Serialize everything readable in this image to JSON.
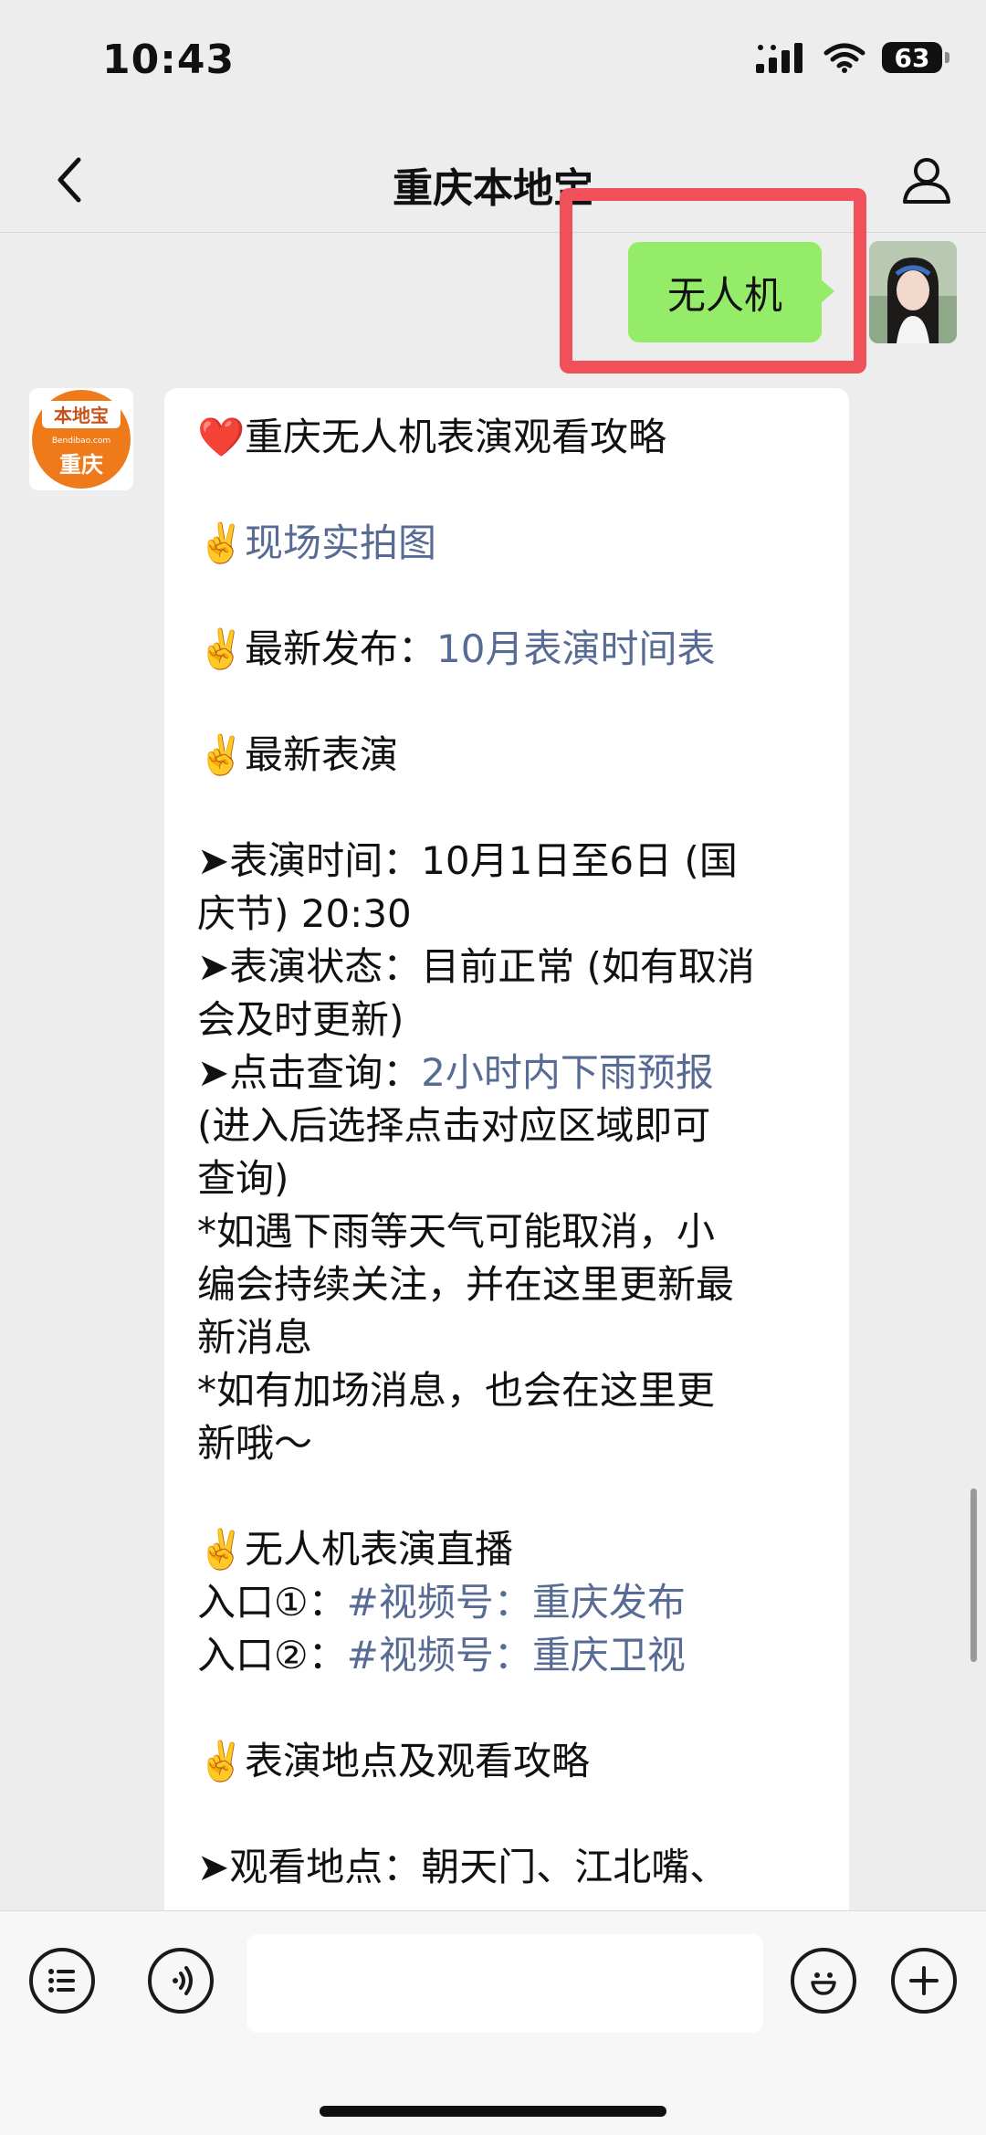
{
  "status_bar": {
    "time": "10:43",
    "battery": "63"
  },
  "nav": {
    "title": "重庆本地宝"
  },
  "sent": {
    "text": "无人机"
  },
  "bot_avatar": {
    "top": "本地宝",
    "url": "Bendibao.com",
    "city": "重庆"
  },
  "message": {
    "l01": "重庆无人机表演观看攻略",
    "l02": "现场实拍图",
    "l03_pre": "最新发布：",
    "l03_link": "10月表演时间表",
    "l04": "最新表演",
    "l05": "➤表演时间：10月1日至6日 (国",
    "l06": "庆节) 20:30",
    "l07": "➤表演状态：目前正常 (如有取消",
    "l08": "会及时更新)",
    "l09_pre": "➤点击查询：",
    "l09_link": "2小时内下雨预报",
    "l10": "(进入后选择点击对应区域即可",
    "l11": "查询)",
    "l12": "*如遇下雨等天气可能取消，小",
    "l13": "编会持续关注，并在这里更新最",
    "l14": "新消息",
    "l15": "*如有加场消息，也会在这里更",
    "l16": "新哦～",
    "l17": "无人机表演直播",
    "l18_pre": "入口①：",
    "l18_link": "#视频号：重庆发布",
    "l19_pre": "入口②：",
    "l19_link": "#视频号：重庆卫视",
    "l20": "表演地点及观看攻略",
    "l21": "➤观看地点：朝天门、江北嘴、",
    "heart": "❤️",
    "victory": "✌️"
  },
  "input": {
    "placeholder": ""
  },
  "icons": {
    "back": "chevron-left-icon",
    "profile": "person-icon",
    "menu": "list-menu-icon",
    "voice": "voice-icon",
    "emoji": "smiley-icon",
    "add": "plus-icon"
  }
}
